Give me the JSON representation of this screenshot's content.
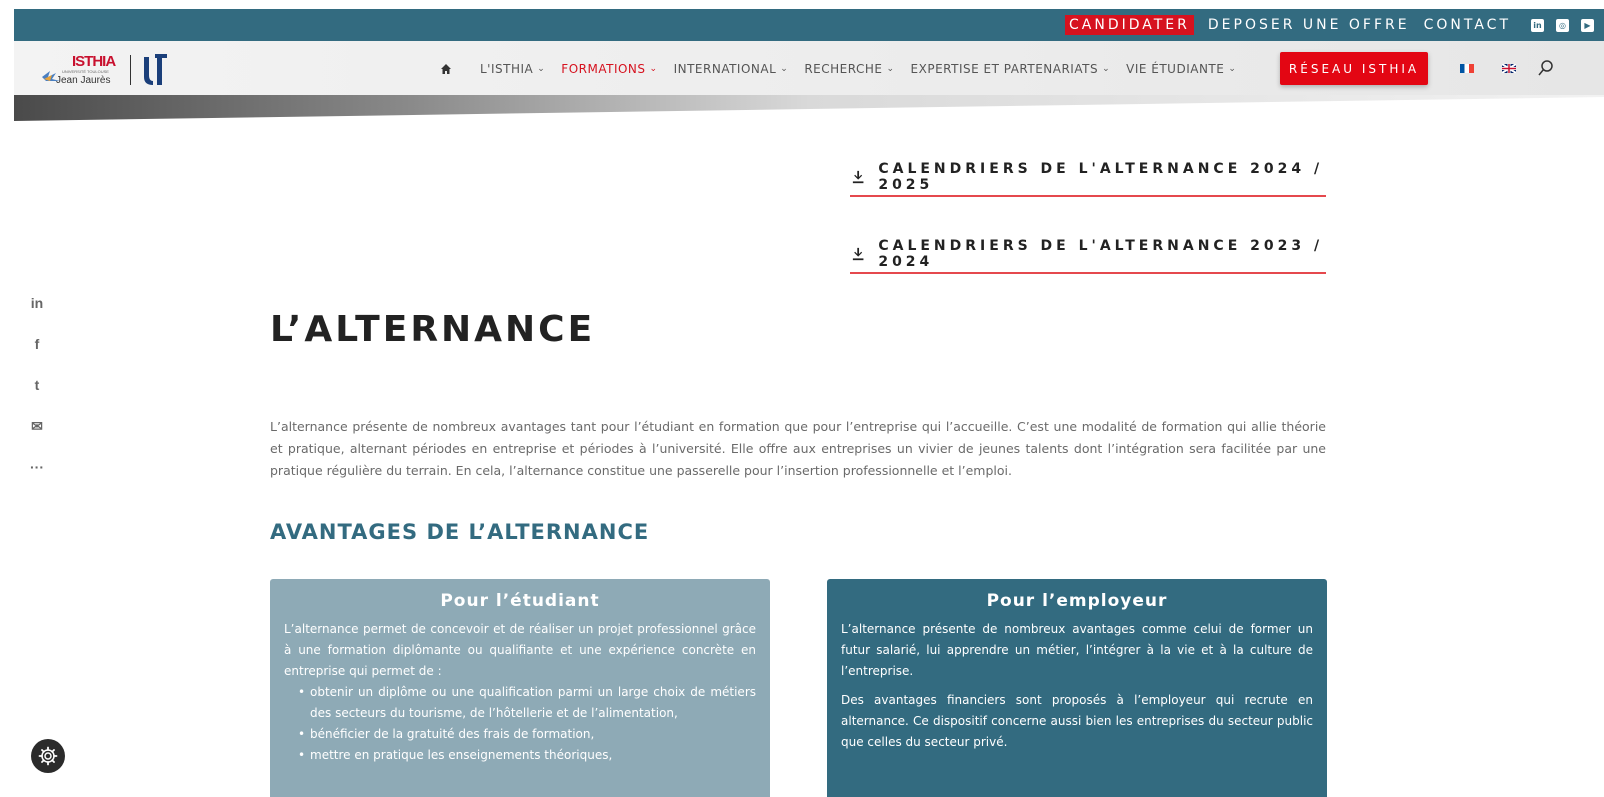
{
  "topbar": {
    "links": [
      "CANDIDATER",
      "DEPOSER UNE OFFRE",
      "CONTACT"
    ],
    "social": [
      "linkedin-icon",
      "instagram-icon",
      "youtube-icon"
    ]
  },
  "nav": {
    "items": [
      {
        "label": "L'ISTHIA",
        "chev": "⌄"
      },
      {
        "label": "FORMATIONS",
        "chev": "⌄"
      },
      {
        "label": "INTERNATIONAL",
        "chev": "⌄"
      },
      {
        "label": "RECHERCHE",
        "chev": "⌄"
      },
      {
        "label": "EXPERTISE ET PARTENARIATS",
        "chev": "⌄"
      },
      {
        "label": "VIE ÉTUDIANTE",
        "chev": "⌄"
      }
    ],
    "reseau_label": "RÉSEAU ISTHIA"
  },
  "logo": {
    "isthia": "ISTHIA",
    "university_small": "UNIVERSITÉ TOULOUSE",
    "university_name": "Jean Jaurès"
  },
  "side_social": [
    "in",
    "f",
    "t",
    "✉",
    "···"
  ],
  "downloads": [
    "CALENDRIERS DE L'ALTERNANCE 2024 / 2025",
    "CALENDRIERS DE L'ALTERNANCE 2023 / 2024"
  ],
  "page": {
    "title": "L’ALTERNANCE",
    "intro": "L’alternance présente de nombreux avantages tant pour l’étudiant en formation que pour l’entreprise qui l’accueille. C’est une modalité de formation qui allie théorie et pratique, alternant périodes en entreprise et périodes à l’université. Elle offre aux entreprises un vivier de jeunes talents dont l’intégration sera facilitée par une pratique régulière du terrain. En cela, l’alternance constitue une passerelle pour l’insertion professionnelle et l’emploi.",
    "subtitle": "AVANTAGES DE L’ALTERNANCE"
  },
  "cards": {
    "student": {
      "title": "Pour l’étudiant",
      "text": "L’alternance permet de concevoir et de réaliser un projet professionnel grâce à une formation diplômante ou qualifiante et une expérience concrète en entreprise qui permet de :",
      "bullets": [
        "obtenir un diplôme ou une qualification parmi un large choix de métiers des secteurs du tourisme, de l’hôtellerie et de l’alimentation,",
        "bénéficier de la gratuité des frais de formation,",
        "mettre en pratique les enseignements théoriques,"
      ]
    },
    "employer": {
      "title": "Pour l’employeur",
      "p1": "L’alternance présente de nombreux avantages comme celui de former un futur salarié, lui apprendre un métier, l’intégrer à la vie et à la culture de l’entreprise.",
      "p2": "Des avantages financiers sont proposés à l’employeur qui recrute en alternance.  Ce dispositif concerne aussi  bien les entreprises du secteur public que celles du secteur privé."
    }
  },
  "colors": {
    "topbar": "#336b80",
    "accent_red": "#e30613",
    "student_card": "#8eaab6",
    "employer_card": "#336b80"
  }
}
